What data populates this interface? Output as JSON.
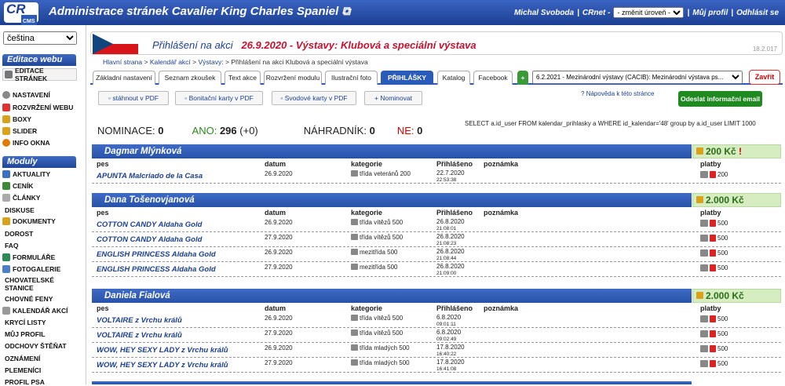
{
  "header": {
    "logo_main": "CR",
    "logo_sub": "CMS",
    "title": "Administrace stránek Cavalier King Charles Spaniel",
    "user": "Michal Svoboda",
    "crnet": "CRnet -",
    "level_select": "- změnit úroveň -",
    "profile_link": "Můj profil",
    "logout_link": "Odhlásit se"
  },
  "sidebar": {
    "language": "čeština",
    "section1": "Editace webu",
    "edit_pages": "EDITACE STRÁNEK",
    "items1": [
      "NASTAVENÍ",
      "ROZVRŽENÍ WEBU",
      "BOXY",
      "SLIDER",
      "INFO OKNA"
    ],
    "section2": "Moduly",
    "items2": [
      "AKTUALITY",
      "CENÍK",
      "ČLÁNKY",
      "DISKUSE",
      "DOKUMENTY",
      "DOROST",
      "FAQ",
      "FORMULÁŘE",
      "FOTOGALERIE",
      "CHOVATELSKÉ STANICE",
      "CHOVNÉ FENY",
      "KALENDÁŘ AKCÍ",
      "KRYCÍ LISTY",
      "MŮJ PROFIL",
      "ODCHOVY ŠTĚŇAT",
      "OZNÁMENÍ",
      "PLEMENÍCI",
      "PROFIL PSA"
    ]
  },
  "page": {
    "title_prefix": "Přihlášení na akci",
    "title_rest": "26.9.2020 - Výstavy: Klubová a speciální výstava",
    "version": "18.2.017",
    "breadcrumb": [
      "Hlavní strana",
      ">",
      "Kalendář akcí",
      ">",
      "Výstavy:",
      ">",
      "Přihlášení na akci Klubová a speciální výstava"
    ]
  },
  "tabs": [
    "Základní nastavení",
    "Seznam zkoušek",
    "Text akce",
    "Rozvržení modulu",
    "Ilustrační foto",
    "PŘIHLÁŠKY",
    "Katalog",
    "Facebook"
  ],
  "tab_add": "+",
  "event_select": "6.2.2021 - Mezinárodní výstavy (CACIB): Mezinárodní výstava ps...",
  "close_button": "Zavřít",
  "actions": {
    "pdf": "stáhnout v PDF",
    "bonit": "Bonitační karty v PDF",
    "summary": "Svodové karty v PDF",
    "nominate": "Nominovat",
    "help": "Nápověda k této stránce",
    "send": "Odeslat informační email"
  },
  "stats": {
    "nom_label": "NOMINACE:",
    "nom_value": "0",
    "ano_label": "ANO:",
    "ano_value": "296",
    "ano_extra": "(+0)",
    "nahr_label": "NÁHRADNÍK:",
    "nahr_value": "0",
    "ne_label": "NE:",
    "ne_value": "0"
  },
  "sql": "SELECT a.id_user FROM kalendar_prihlasky a WHERE id_kalendar='48' group by a.id_user LIMIT 1000",
  "columns": {
    "dog": "pes",
    "date": "datum",
    "cat": "kategorie",
    "reg": "Přihlášeno",
    "note": "poznámka",
    "pay": "platby"
  },
  "groups": [
    {
      "owner": "Dagmar Mlýnková",
      "sum": "200 Kč",
      "mark": "!",
      "rows": [
        {
          "dog": "APUNTA Malcriado de la Casa",
          "date": "26.9.2020",
          "cat": "třída veteránů 200",
          "reg_date": "22.7.2020",
          "reg_time": "22:53:38",
          "pay": "200"
        }
      ]
    },
    {
      "owner": "Dana Tošenovjanová",
      "sum": "2.000 Kč",
      "mark": "",
      "rows": [
        {
          "dog": "COTTON CANDY Aldaha Gold",
          "date": "26.9.2020",
          "cat": "třída vítězů 500",
          "reg_date": "26.8.2020",
          "reg_time": "21:08:01",
          "pay": "500"
        },
        {
          "dog": "COTTON CANDY Aldaha Gold",
          "date": "27.9.2020",
          "cat": "třída vítězů 500",
          "reg_date": "26.8.2020",
          "reg_time": "21:08:23",
          "pay": "500"
        },
        {
          "dog": "ENGLISH PRINCESS Aldaha Gold",
          "date": "26.9.2020",
          "cat": "mezitřída 500",
          "reg_date": "26.8.2020",
          "reg_time": "21:08:44",
          "pay": "500"
        },
        {
          "dog": "ENGLISH PRINCESS Aldaha Gold",
          "date": "27.9.2020",
          "cat": "mezitřída 500",
          "reg_date": "26.8.2020",
          "reg_time": "21:09:00",
          "pay": "500"
        }
      ]
    },
    {
      "owner": "Daniela Fialová",
      "sum": "2.000 Kč",
      "mark": "",
      "rows": [
        {
          "dog": "VOLTAIRE z Vrchu králů",
          "date": "26.9.2020",
          "cat": "třída vítězů 500",
          "reg_date": "6.8.2020",
          "reg_time": "09:01:11",
          "pay": "500"
        },
        {
          "dog": "VOLTAIRE z Vrchu králů",
          "date": "27.9.2020",
          "cat": "třída vítězů 500",
          "reg_date": "6.8.2020",
          "reg_time": "09:02:49",
          "pay": "500"
        },
        {
          "dog": "WOW, HEY SEXY LADY z Vrchu králů",
          "date": "26.9.2020",
          "cat": "třída mladých 500",
          "reg_date": "17.8.2020",
          "reg_time": "16:40:22",
          "pay": "500"
        },
        {
          "dog": "WOW, HEY SEXY LADY z Vrchu králů",
          "date": "27.9.2020",
          "cat": "třída mladých 500",
          "reg_date": "17.8.2020",
          "reg_time": "16:41:08",
          "pay": "500"
        }
      ]
    }
  ]
}
